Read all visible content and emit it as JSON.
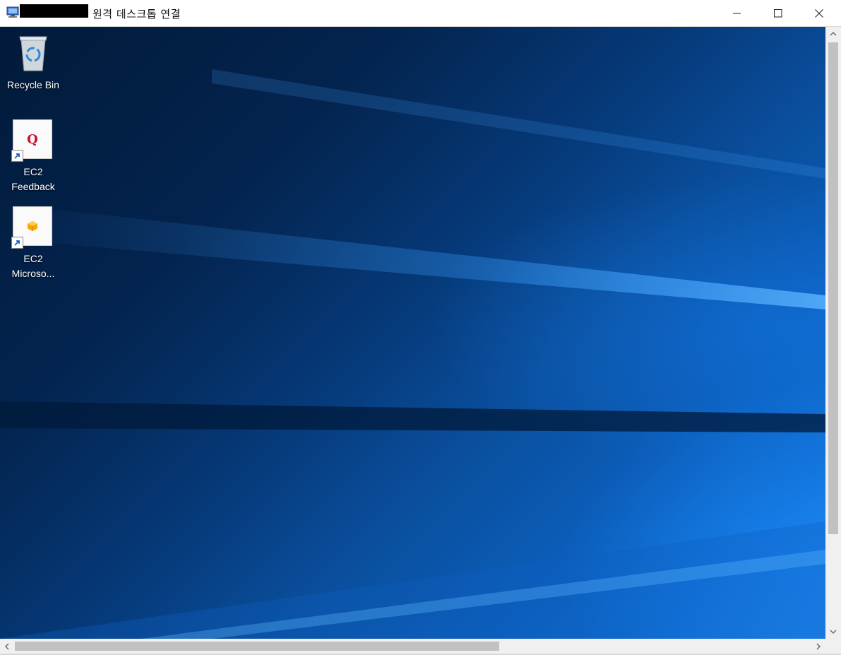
{
  "window": {
    "title": "원격 데스크톱 연결",
    "redacted_hostname": true
  },
  "controls": {
    "minimize": "minimize",
    "maximize": "maximize",
    "close": "close"
  },
  "desktop": {
    "icons": [
      {
        "label": "Recycle Bin",
        "icon": "recycle-bin-icon"
      },
      {
        "label": "EC2\nFeedback",
        "icon": "ec2-feedback-icon",
        "glyph": "Q"
      },
      {
        "label": "EC2\nMicroso...",
        "icon": "ec2-microsoft-icon"
      }
    ]
  },
  "colors": {
    "feedback_glyph": "#c8102e",
    "aws_box": "#f7a700",
    "wallpaper_dark": "#021a3a",
    "wallpaper_light": "#1e88ee"
  }
}
